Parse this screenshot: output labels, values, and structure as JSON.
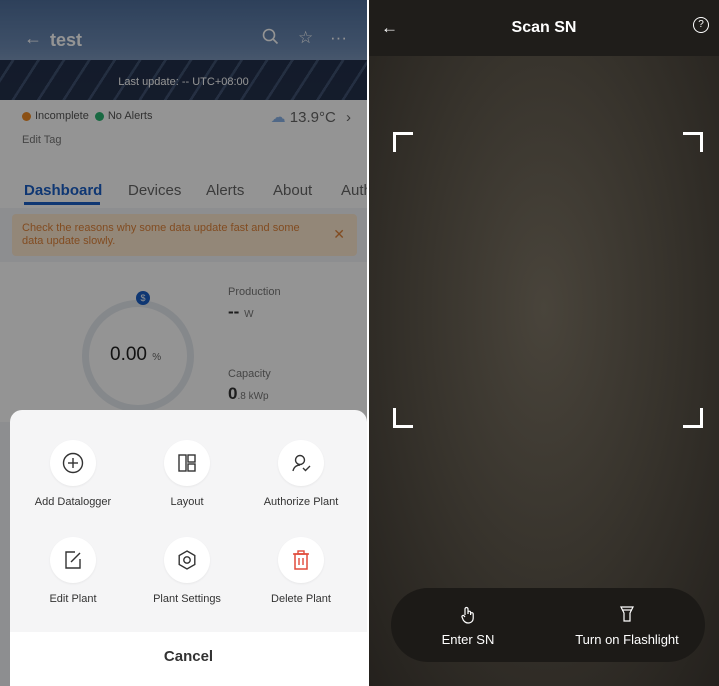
{
  "left": {
    "header": {
      "title": "test",
      "last_update": "Last update: -- UTC+08:00"
    },
    "status": {
      "incomplete": "Incomplete",
      "no_alerts": "No Alerts",
      "temperature": "13.9°C",
      "edit_tag": "Edit Tag"
    },
    "tabs": [
      "Dashboard",
      "Devices",
      "Alerts",
      "About",
      "Auth"
    ],
    "banner": {
      "text": "Check the reasons why some data update fast and some data update slowly."
    },
    "dashboard": {
      "percent_value": "0.00",
      "percent_unit": "%",
      "production_label": "Production",
      "production_value": "--",
      "production_unit": "W",
      "capacity_label": "Capacity",
      "capacity_value": "0",
      "capacity_unit": ".8 kWp"
    },
    "sheet": {
      "actions": [
        {
          "label": "Add Datalogger",
          "icon": "plus-circle-icon"
        },
        {
          "label": "Layout",
          "icon": "layout-grid-icon"
        },
        {
          "label": "Authorize Plant",
          "icon": "user-check-icon"
        },
        {
          "label": "Edit Plant",
          "icon": "edit-icon"
        },
        {
          "label": "Plant Settings",
          "icon": "gear-icon"
        },
        {
          "label": "Delete Plant",
          "icon": "trash-icon"
        }
      ],
      "cancel": "Cancel"
    }
  },
  "right": {
    "title": "Scan SN",
    "enter_sn": "Enter SN",
    "flashlight": "Turn on Flashlight"
  },
  "colors": {
    "accent": "#1b5fc6",
    "warning": "#e0843a",
    "danger": "#e04a3a",
    "incomplete": "#f08a24",
    "ok": "#2bb673"
  }
}
